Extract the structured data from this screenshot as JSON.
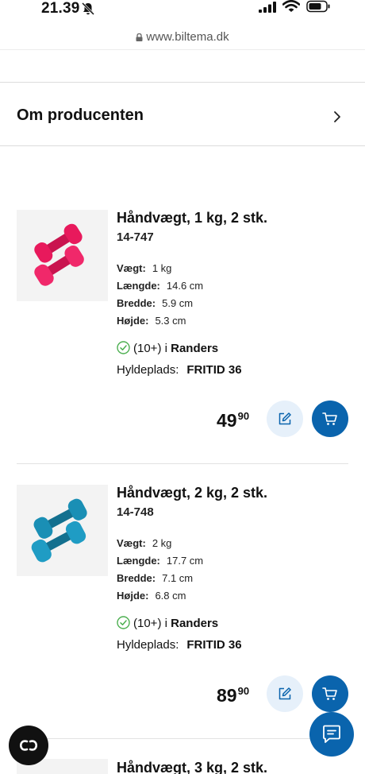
{
  "status_bar": {
    "time": "21.39",
    "icons": [
      "bell-slash-icon",
      "signal-icon",
      "wifi-icon",
      "battery-icon"
    ]
  },
  "browser": {
    "url": "www.biltema.dk"
  },
  "section": {
    "title": "Om producenten"
  },
  "products": [
    {
      "name": "Håndvægt, 1 kg, 2 stk.",
      "sku": "14-747",
      "image": "pink-dumbbells",
      "specs": [
        {
          "label": "Vægt:",
          "value": "1 kg"
        },
        {
          "label": "Længde:",
          "value": "14.6 cm"
        },
        {
          "label": "Bredde:",
          "value": "5.9 cm"
        },
        {
          "label": "Højde:",
          "value": "5.3 cm"
        }
      ],
      "stock_count": "(10+) i",
      "stock_store": "Randers",
      "shelf_label": "Hyldeplads:",
      "shelf_value": "FRITID 36",
      "price_main": "49",
      "price_decimals": "90"
    },
    {
      "name": "Håndvægt, 2 kg, 2 stk.",
      "sku": "14-748",
      "image": "teal-dumbbells",
      "specs": [
        {
          "label": "Vægt:",
          "value": "2 kg"
        },
        {
          "label": "Længde:",
          "value": "17.7 cm"
        },
        {
          "label": "Bredde:",
          "value": "7.1 cm"
        },
        {
          "label": "Højde:",
          "value": "6.8 cm"
        }
      ],
      "stock_count": "(10+) i",
      "stock_store": "Randers",
      "shelf_label": "Hyldeplads:",
      "shelf_value": "FRITID 36",
      "price_main": "89",
      "price_decimals": "90"
    },
    {
      "name": "Håndvægt, 3 kg, 2 stk."
    }
  ],
  "colors": {
    "accent": "#0a64ad",
    "accent_light": "#e6f0fa",
    "stock_ok": "#4caf50",
    "pink_dumbbell": "#e8195c",
    "teal_dumbbell": "#1a8fb5"
  }
}
